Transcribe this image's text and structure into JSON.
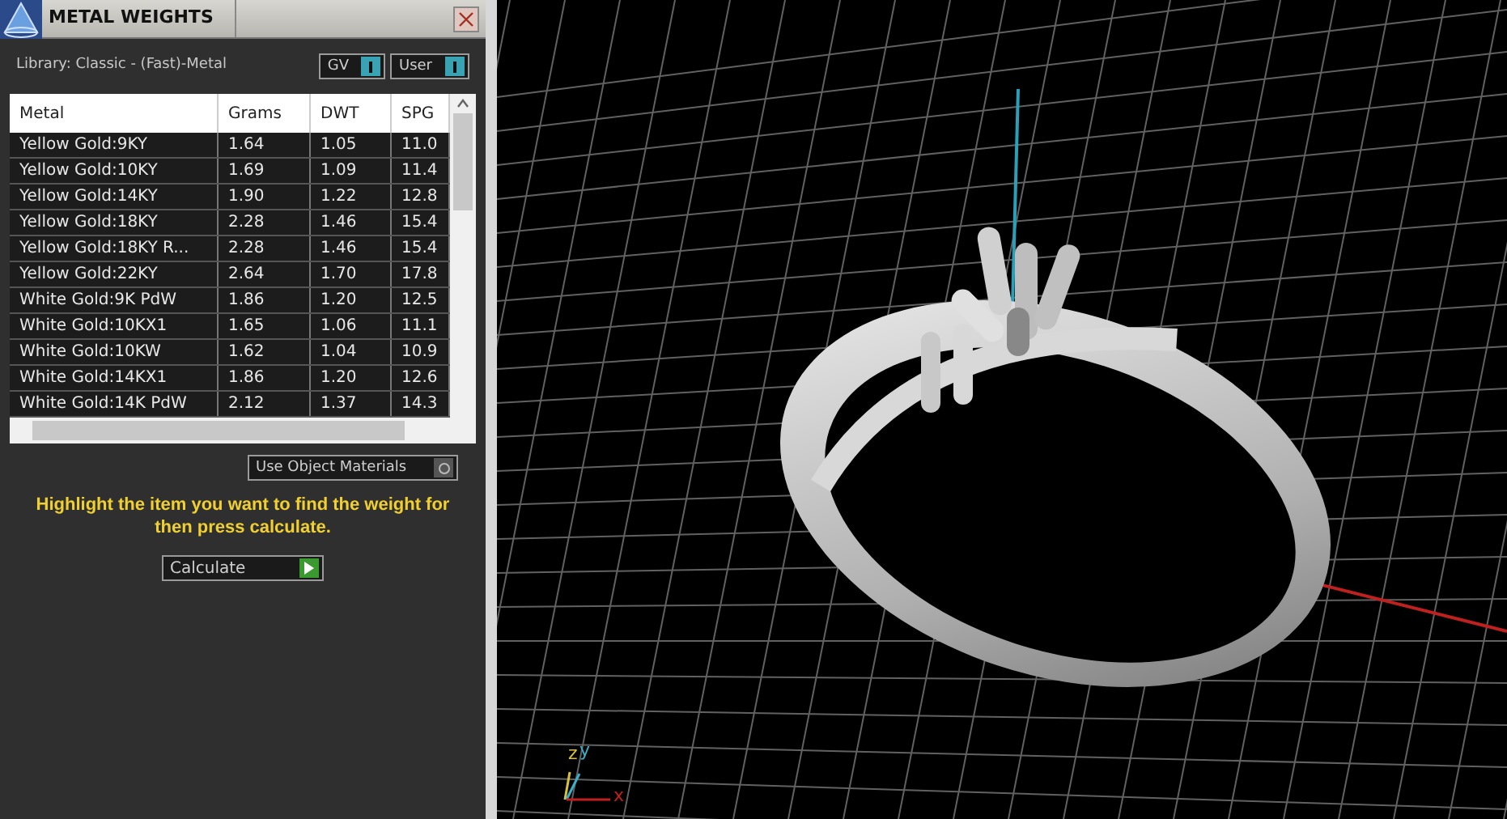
{
  "panel": {
    "title": "METAL WEIGHTS",
    "library": "Library: Classic - (Fast)-Metal",
    "toggles": [
      {
        "label": "GV",
        "on": true
      },
      {
        "label": "User",
        "on": true
      }
    ],
    "table": {
      "columns": [
        "Metal",
        "Grams",
        "DWT",
        "SPG"
      ],
      "rows": [
        [
          "Yellow Gold:9KY",
          "1.64",
          "1.05",
          "11.0"
        ],
        [
          "Yellow Gold:10KY",
          "1.69",
          "1.09",
          "11.4"
        ],
        [
          "Yellow Gold:14KY",
          "1.90",
          "1.22",
          "12.8"
        ],
        [
          "Yellow Gold:18KY",
          "2.28",
          "1.46",
          "15.4"
        ],
        [
          "Yellow Gold:18KY R...",
          "2.28",
          "1.46",
          "15.4"
        ],
        [
          "Yellow Gold:22KY",
          "2.64",
          "1.70",
          "17.8"
        ],
        [
          "White Gold:9K PdW",
          "1.86",
          "1.20",
          "12.5"
        ],
        [
          "White Gold:10KX1",
          "1.65",
          "1.06",
          "11.1"
        ],
        [
          "White Gold:10KW",
          "1.62",
          "1.04",
          "10.9"
        ],
        [
          "White Gold:14KX1",
          "1.86",
          "1.20",
          "12.6"
        ],
        [
          "White Gold:14K PdW",
          "2.12",
          "1.37",
          "14.3"
        ]
      ]
    },
    "object_materials": {
      "label": "Use Object Materials",
      "on": false
    },
    "hint": "Highlight the item you want to find the weight for then press calculate.",
    "calculate": "Calculate"
  },
  "viewport": {
    "axis_labels": [
      "z",
      "y",
      "x"
    ]
  }
}
